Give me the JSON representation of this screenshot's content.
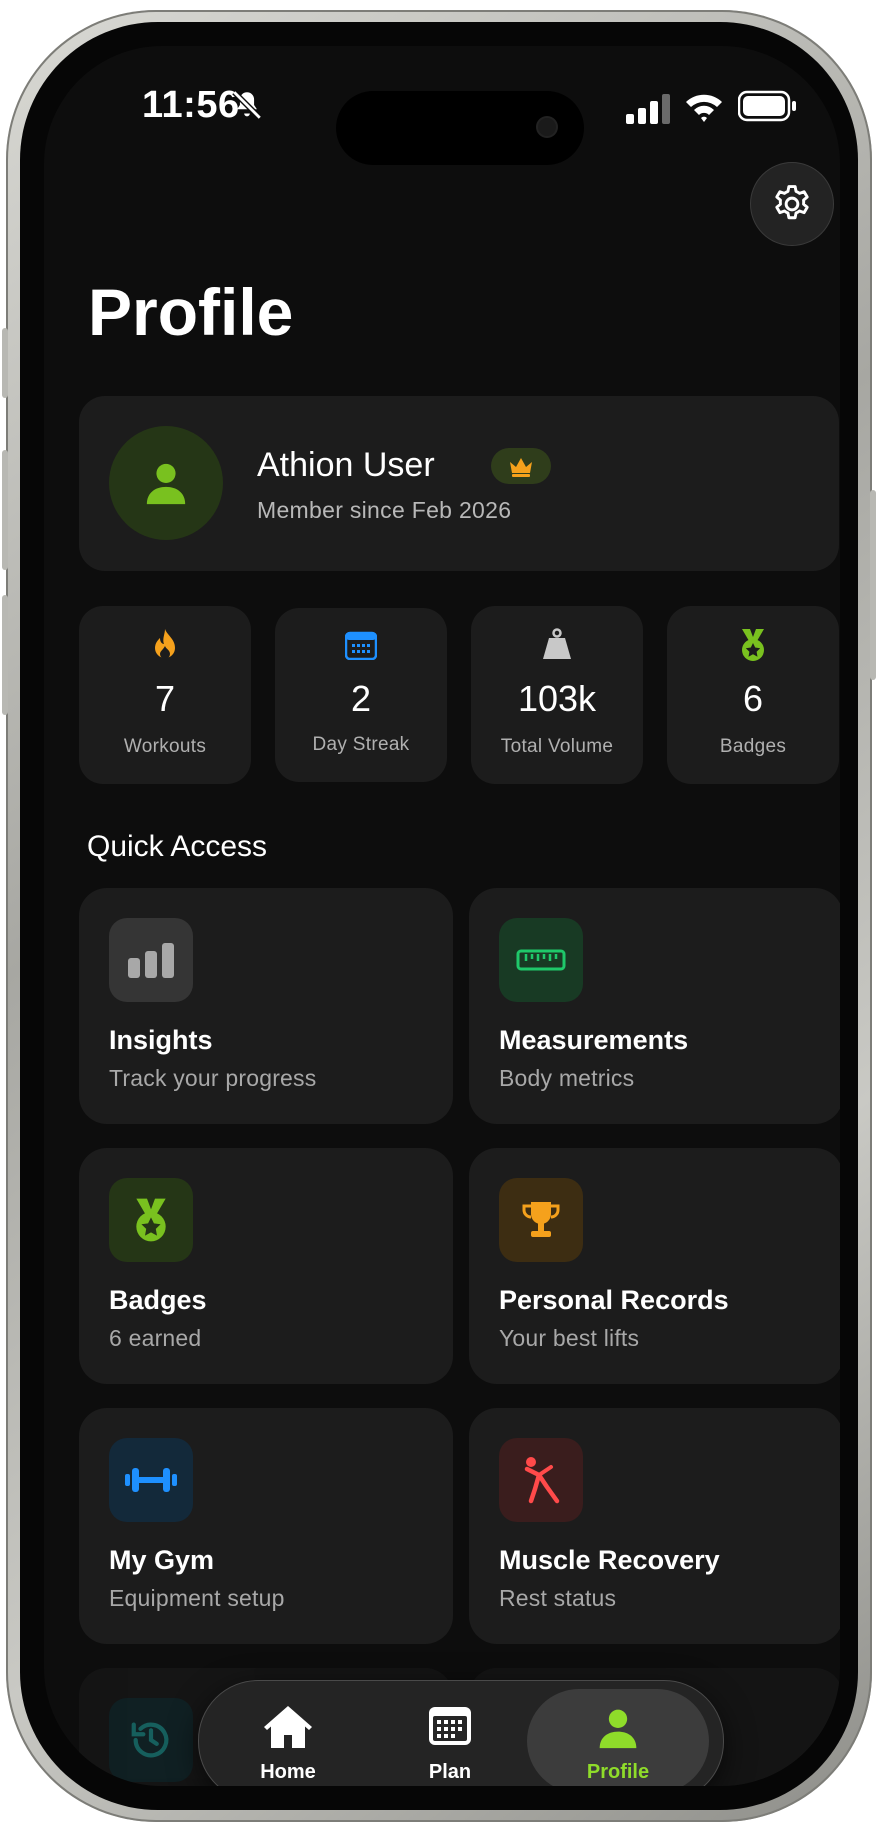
{
  "status_bar": {
    "time": "11:56"
  },
  "header": {
    "title": "Profile"
  },
  "profile": {
    "name": "Athion User",
    "member_since": "Member since Feb 2026"
  },
  "stats": [
    {
      "icon": "flame-icon",
      "value": "7",
      "label": "Workouts",
      "color": "#f5a11c"
    },
    {
      "icon": "calendar-icon",
      "value": "2",
      "label": "Day Streak",
      "color": "#1e90ff"
    },
    {
      "icon": "weight-icon",
      "value": "103k",
      "label": "Total Volume",
      "color": "#c8c8c8"
    },
    {
      "icon": "medal-icon",
      "value": "6",
      "label": "Badges",
      "color": "#79c11f"
    }
  ],
  "quick_access": {
    "title": "Quick Access",
    "items": [
      {
        "icon": "bar-chart-icon",
        "title": "Insights",
        "subtitle": "Track your progress"
      },
      {
        "icon": "ruler-icon",
        "title": "Measurements",
        "subtitle": "Body metrics"
      },
      {
        "icon": "medal-icon",
        "title": "Badges",
        "subtitle": "6 earned"
      },
      {
        "icon": "trophy-icon",
        "title": "Personal Records",
        "subtitle": "Your best lifts"
      },
      {
        "icon": "dumbbell-icon",
        "title": "My Gym",
        "subtitle": "Equipment setup"
      },
      {
        "icon": "stretch-icon",
        "title": "Muscle Recovery",
        "subtitle": "Rest status"
      }
    ]
  },
  "tab_bar": {
    "tabs": [
      {
        "label": "Home",
        "icon": "home-icon"
      },
      {
        "label": "Plan",
        "icon": "calendar-icon"
      },
      {
        "label": "Profile",
        "icon": "person-icon",
        "active": true
      }
    ]
  },
  "colors": {
    "accent": "#8fdc2a",
    "background": "#0d0d0d",
    "card": "#1c1c1c"
  }
}
